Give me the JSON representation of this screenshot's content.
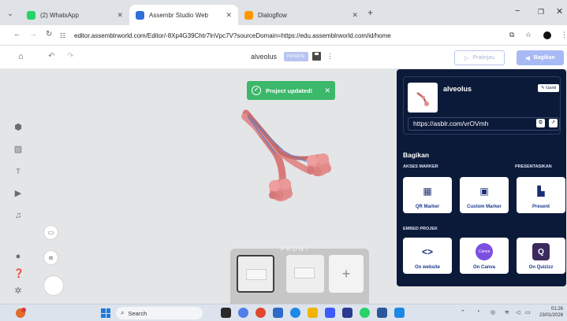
{
  "browser": {
    "tabs": [
      {
        "title": "(2) WhatsApp",
        "icon": "whatsapp-icon"
      },
      {
        "title": "Assembr Studio Web",
        "icon": "assemblr-icon"
      },
      {
        "title": "Dialogflow",
        "icon": "dialogflow-icon"
      }
    ],
    "active_tab": 1,
    "url": "editor.assemblrworld.com/Editor/-8Xp4G39Chtr7lnVpc7V?sourceDomain=https://edu.assemblrworld.com/id/home"
  },
  "editor": {
    "project_title": "alveolus",
    "privacy_badge": "PRIVATE",
    "preview_label": "Pratinjau",
    "share_label": "Bagikan",
    "toast_message": "Project updated!",
    "view_label": "FRONT"
  },
  "share_panel": {
    "project_name": "alveolus",
    "change_label": "Ganti",
    "link": "https://asblr.com/vrOVmh",
    "section_title": "Bagikan",
    "marker_label": "AKSES MARKER",
    "present_section_label": "PRESENTASIKAN",
    "embed_label": "EMBED PROJEK",
    "options": {
      "qr": "QR Marker",
      "custom": "Custom Marker",
      "present": "Present",
      "website": "On website",
      "canva": "On Canva",
      "quizizz": "On Quizizz"
    },
    "canva_logo_text": "Canva"
  },
  "taskbar": {
    "search_placeholder": "Search",
    "time": "01:26",
    "date": "23/01/2026"
  },
  "colors": {
    "panel_bg": "#0c1a3a",
    "toast_green": "#3bb86a",
    "share_button": "#a8baf5",
    "accent_blue": "#1b3a8c"
  }
}
